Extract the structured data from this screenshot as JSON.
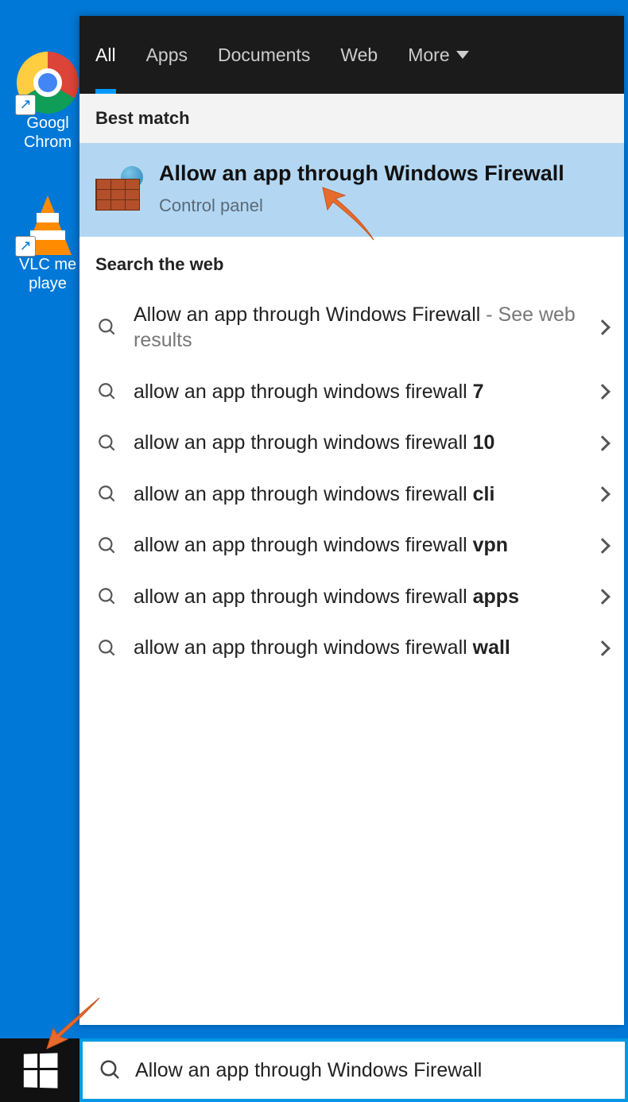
{
  "desktop": {
    "icons": [
      {
        "name": "chrome",
        "label": "Google Chrome",
        "label_visible": "Googl Chrom"
      },
      {
        "name": "vlc",
        "label": "VLC media player",
        "label_visible": "VLC me playe"
      }
    ]
  },
  "search_panel": {
    "tabs": [
      {
        "label": "All",
        "active": true
      },
      {
        "label": "Apps",
        "active": false
      },
      {
        "label": "Documents",
        "active": false
      },
      {
        "label": "Web",
        "active": false
      },
      {
        "label": "More",
        "active": false,
        "has_dropdown": true
      }
    ],
    "best_match_header": "Best match",
    "best_match": {
      "title": "Allow an app through Windows Firewall",
      "subtitle": "Control panel"
    },
    "web_header": "Search the web",
    "web_results": [
      {
        "prefix": "Allow an app through Windows Firewall",
        "bold": "",
        "suffix": " - See web results",
        "suffix_light": true
      },
      {
        "prefix": "allow an app through windows firewall ",
        "bold": "7",
        "suffix": ""
      },
      {
        "prefix": "allow an app through windows firewall ",
        "bold": "10",
        "suffix": ""
      },
      {
        "prefix": "allow an app through windows firewall ",
        "bold": "cli",
        "suffix": ""
      },
      {
        "prefix": "allow an app through windows firewall ",
        "bold": "vpn",
        "suffix": ""
      },
      {
        "prefix": "allow an app through windows firewall ",
        "bold": "apps",
        "suffix": ""
      },
      {
        "prefix": "allow an app through windows firewall ",
        "bold": "wall",
        "suffix": ""
      }
    ]
  },
  "taskbar": {
    "search_value": "Allow an app through Windows Firewall"
  },
  "colors": {
    "desktop_bg": "#0078d7",
    "tab_active_underline": "#0099ff",
    "best_match_bg": "#b3d7f2",
    "arrow": "#e96b2c"
  }
}
